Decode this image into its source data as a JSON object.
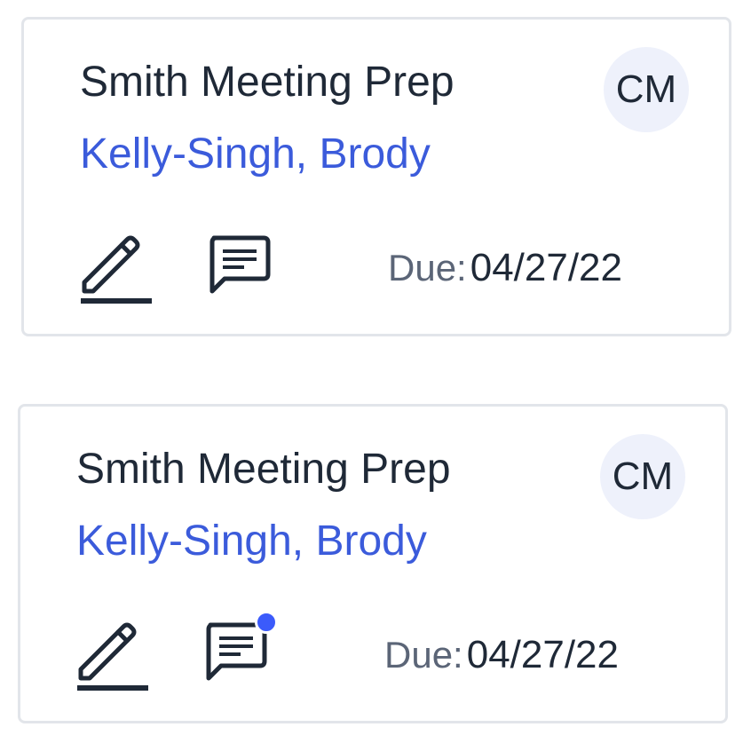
{
  "cards": [
    {
      "title": "Smith Meeting Prep",
      "client": "Kelly-Singh, Brody",
      "assignee_initials": "CM",
      "due_label": "Due:",
      "due_date": "04/27/22",
      "edit_icon": "pencil-edit-icon",
      "comment_icon": "comment-icon",
      "has_unread_comments": false
    },
    {
      "title": "Smith Meeting Prep",
      "client": "Kelly-Singh, Brody",
      "assignee_initials": "CM",
      "due_label": "Due:",
      "due_date": "04/27/22",
      "edit_icon": "pencil-edit-icon",
      "comment_icon": "comment-icon",
      "has_unread_comments": true
    }
  ],
  "colors": {
    "title": "#1f2937",
    "client_link": "#3b5bdb",
    "avatar_bg": "#eef1fb",
    "notification_dot": "#3b5bfb",
    "card_border": "#e2e5ea"
  }
}
